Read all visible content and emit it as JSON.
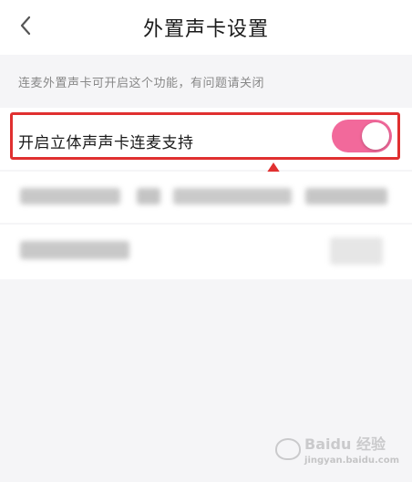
{
  "header": {
    "back_icon": "chevron-left-icon",
    "title": "外置声卡设置"
  },
  "description": "连麦外置声卡可开启这个功能，有问题请关闭",
  "settings": [
    {
      "label": "开启立体声声卡连麦支持",
      "toggle_on": true
    }
  ],
  "colors": {
    "toggle_on": "#f2699b",
    "highlight": "#e03030",
    "background": "#f5f5f7"
  },
  "watermark": {
    "text": "Baidu 经验",
    "sub": "jingyan.baidu.com"
  }
}
